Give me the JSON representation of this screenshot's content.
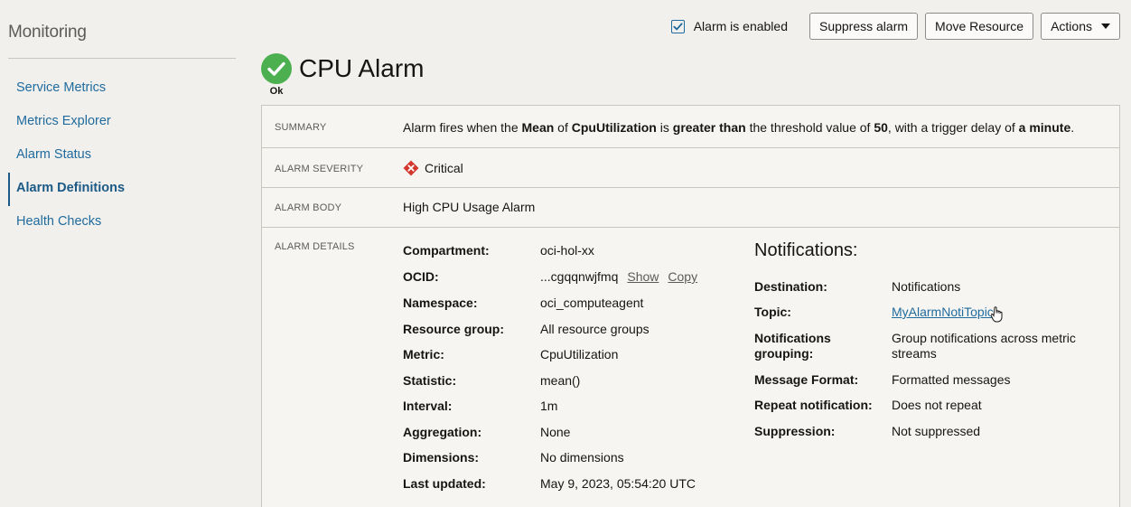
{
  "sidebar": {
    "title": "Monitoring",
    "items": [
      {
        "label": "Service Metrics",
        "active": false
      },
      {
        "label": "Metrics Explorer",
        "active": false
      },
      {
        "label": "Alarm Status",
        "active": false
      },
      {
        "label": "Alarm Definitions",
        "active": true
      },
      {
        "label": "Health Checks",
        "active": false
      }
    ]
  },
  "toolbar": {
    "enabled_label": "Alarm is enabled",
    "enabled_checked": true,
    "suppress_label": "Suppress alarm",
    "move_label": "Move Resource",
    "actions_label": "Actions"
  },
  "header": {
    "status": "Ok",
    "title": "CPU Alarm"
  },
  "summary": {
    "label": "SUMMARY",
    "parts": [
      "Alarm fires when the ",
      "Mean",
      " of ",
      "CpuUtilization",
      " is ",
      "greater than",
      " the threshold value of ",
      "50",
      ", with a trigger delay of ",
      "a minute",
      "."
    ]
  },
  "severity": {
    "label": "ALARM SEVERITY",
    "value": "Critical"
  },
  "body": {
    "label": "ALARM BODY",
    "value": "High CPU Usage Alarm"
  },
  "details": {
    "label": "ALARM DETAILS",
    "fields": [
      {
        "key": "Compartment:",
        "value": "oci-hol-xx"
      },
      {
        "key": "OCID:",
        "value": "...cgqqnwjfmq",
        "show": "Show",
        "copy": "Copy"
      },
      {
        "key": "Namespace:",
        "value": "oci_computeagent"
      },
      {
        "key": "Resource group:",
        "value": "All resource groups"
      },
      {
        "key": "Metric:",
        "value": "CpuUtilization"
      },
      {
        "key": "Statistic:",
        "value": "mean()"
      },
      {
        "key": "Interval:",
        "value": "1m"
      },
      {
        "key": "Aggregation:",
        "value": "None"
      },
      {
        "key": "Dimensions:",
        "value": "No dimensions"
      },
      {
        "key": "Last updated:",
        "value": "May 9, 2023, 05:54:20 UTC"
      }
    ]
  },
  "notifications": {
    "title": "Notifications:",
    "fields": [
      {
        "key": "Destination:",
        "value": "Notifications"
      },
      {
        "key": "Topic:",
        "value": "MyAlarmNotiTopic"
      },
      {
        "key_line1": "Notifications",
        "key_line2": "grouping:",
        "value_line1": "Group notifications across metric",
        "value_line2": "streams"
      },
      {
        "key": "Message Format:",
        "value": "Formatted messages"
      },
      {
        "key": "Repeat notification:",
        "value": "Does not repeat"
      },
      {
        "key": "Suppression:",
        "value": "Not suppressed"
      }
    ]
  },
  "colors": {
    "accent": "#1f6b9e",
    "ok_green": "#4caf50",
    "critical_red": "#d3382f",
    "background": "#f2f0ed"
  },
  "icons": [
    "check-circle-icon",
    "critical-diamond-icon",
    "checkbox-check-icon",
    "caret-down-icon",
    "hand-cursor-icon"
  ]
}
